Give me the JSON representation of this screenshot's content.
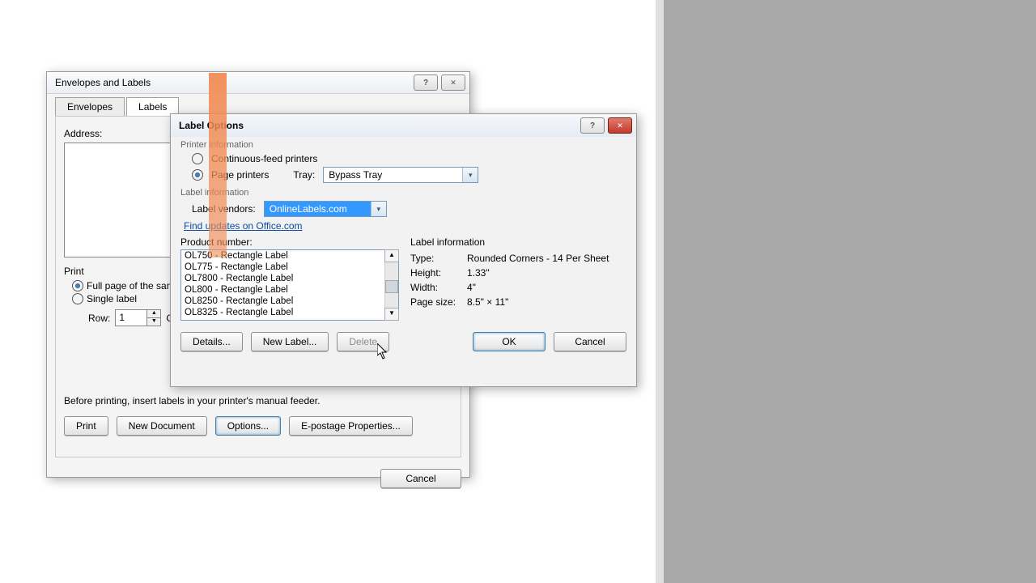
{
  "env_dialog": {
    "title": "Envelopes and Labels",
    "tabs": {
      "envelopes": "Envelopes",
      "labels": "Labels"
    },
    "address_label": "Address:",
    "print_group": "Print",
    "full_page_label": "Full page of the sam",
    "single_label": "Single label",
    "row_label": "Row:",
    "row_value": "1",
    "before_text": "Before printing, insert labels in your printer's manual feeder.",
    "buttons": {
      "print": "Print",
      "new_document": "New Document",
      "options": "Options...",
      "epostage": "E-postage Properties...",
      "cancel": "Cancel"
    }
  },
  "opt_dialog": {
    "title": "Label Options",
    "printer_info": "Printer information",
    "continuous": "Continuous-feed printers",
    "page_printers": "Page printers",
    "tray_label": "Tray:",
    "tray_value": "Bypass Tray",
    "label_info_group": "Label information",
    "vendor_label": "Label vendors:",
    "vendor_value": "OnlineLabels.com",
    "update_link": "Find updates on Office.com",
    "product_number_label": "Product number:",
    "products": [
      "OL750 - Rectangle Label",
      "OL775 - Rectangle Label",
      "OL7800 - Rectangle Label",
      "OL800 - Rectangle Label",
      "OL8250 - Rectangle Label",
      "OL8325 - Rectangle Label"
    ],
    "label_info_title": "Label information",
    "info": {
      "type_label": "Type:",
      "type_value": "Rounded Corners - 14 Per Sheet",
      "height_label": "Height:",
      "height_value": "1.33\"",
      "width_label": "Width:",
      "width_value": "4\"",
      "page_size_label": "Page size:",
      "page_size_value": "8.5\" × 11\""
    },
    "buttons": {
      "details": "Details...",
      "new_label": "New Label...",
      "delete": "Delete",
      "ok": "OK",
      "cancel": "Cancel"
    }
  }
}
